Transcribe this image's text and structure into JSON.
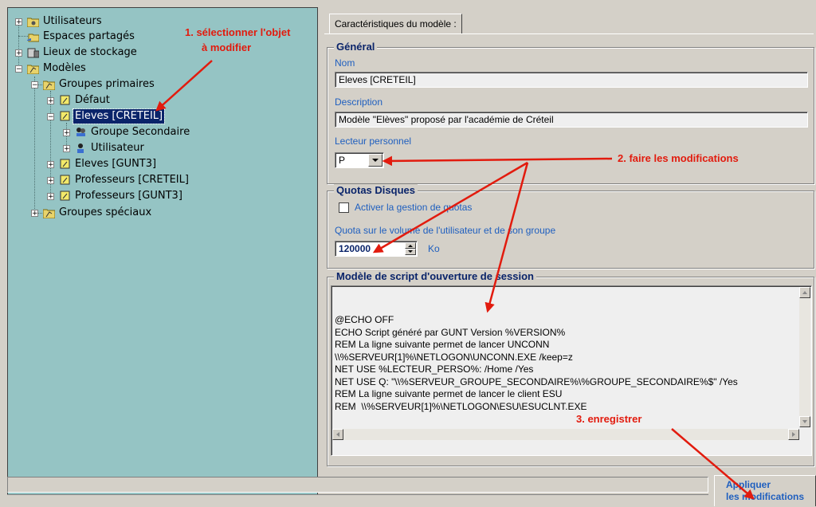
{
  "tree": {
    "items": [
      {
        "label": "Utilisateurs"
      },
      {
        "label": "Espaces partagés"
      },
      {
        "label": "Lieux de stockage"
      },
      {
        "label": "Modèles"
      },
      {
        "label": "Groupes primaires"
      },
      {
        "label": "Défaut"
      },
      {
        "label": "Eleves [CRETEIL]"
      },
      {
        "label": "Groupe Secondaire"
      },
      {
        "label": "Utilisateur"
      },
      {
        "label": "Eleves [GUNT3]"
      },
      {
        "label": "Professeurs [CRETEIL]"
      },
      {
        "label": "Professeurs [GUNT3]"
      },
      {
        "label": "Groupes spéciaux"
      }
    ]
  },
  "tab": {
    "label": "Caractéristiques du modèle :"
  },
  "general": {
    "title": "Général",
    "nom_label": "Nom",
    "nom_value": "Eleves [CRETEIL]",
    "desc_label": "Description",
    "desc_value": "Modèle \"Elèves\" proposé par l'académie de Créteil",
    "lecteur_label": "Lecteur personnel",
    "lecteur_value": "P"
  },
  "quotas": {
    "title": "Quotas Disques",
    "checkbox_label": "Activer la gestion de quotas",
    "volume_label": "Quota sur le volume de l'utilisateur et de son groupe",
    "volume_value": "120000",
    "unit": "Ko"
  },
  "script": {
    "title": "Modèle de script d'ouverture de session",
    "content": "@ECHO OFF\nECHO Script généré par GUNT Version %VERSION%\nREM La ligne suivante permet de lancer UNCONN\n\\\\%SERVEUR[1]%\\NETLOGON\\UNCONN.EXE /keep=z\nNET USE %LECTEUR_PERSO%: /Home /Yes\nNET USE Q: \"\\\\%SERVEUR_GROUPE_SECONDAIRE%\\%GROUPE_SECONDAIRE%$\" /Yes\nREM La ligne suivante permet de lancer le client ESU\nREM  \\\\%SERVEUR[1]%\\NETLOGON\\ESU\\ESUCLNT.EXE"
  },
  "apply_button": {
    "line1": "Appliquer",
    "line2": "les modifications"
  },
  "annotations": {
    "step1_line1": "1. sélectionner l'objet",
    "step1_line2": "à modifier",
    "step2": "2. faire les modifications",
    "step3": "3. enregistrer"
  },
  "colors": {
    "tree_bg": "#95c4c4",
    "window_bg": "#d4d0c8",
    "selection": "#0a246a",
    "annotation": "#e21b0e",
    "legend": "#0a246a",
    "field_label": "#1f5fbf"
  }
}
